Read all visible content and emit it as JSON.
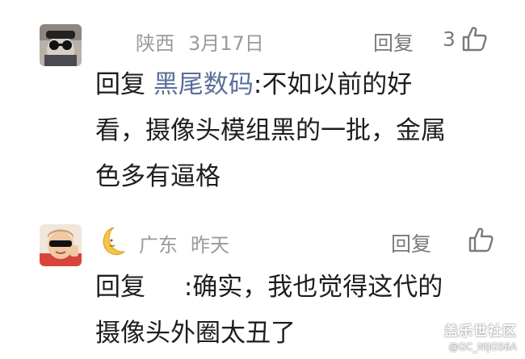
{
  "comments": [
    {
      "location": "陕西",
      "date": "3月17日",
      "reply_label": "回复",
      "like_count": "3",
      "reply_prefix": "回复",
      "reply_target": "黑尾数码",
      "separator": ":",
      "line1": "不如以前的好",
      "line2": "看，摄像头模组黑的一批，金属",
      "line3": "色多有逼格"
    },
    {
      "location": "广东",
      "date": "昨天",
      "reply_label": "回复",
      "like_count": "",
      "reply_prefix": "回复",
      "separator": ":",
      "line1": "确实，我也觉得这代的",
      "line2": "摄像头外圈太丑了"
    }
  ],
  "watermark": {
    "title": "盖乐世社区",
    "user": "@GC_NIJGS6A"
  },
  "icons": {
    "like": "thumbs-up-icon",
    "badge": "moon-icon"
  },
  "colors": {
    "meta": "#9a9a9a",
    "text": "#1e1e1e",
    "link": "#5a6f9a"
  }
}
